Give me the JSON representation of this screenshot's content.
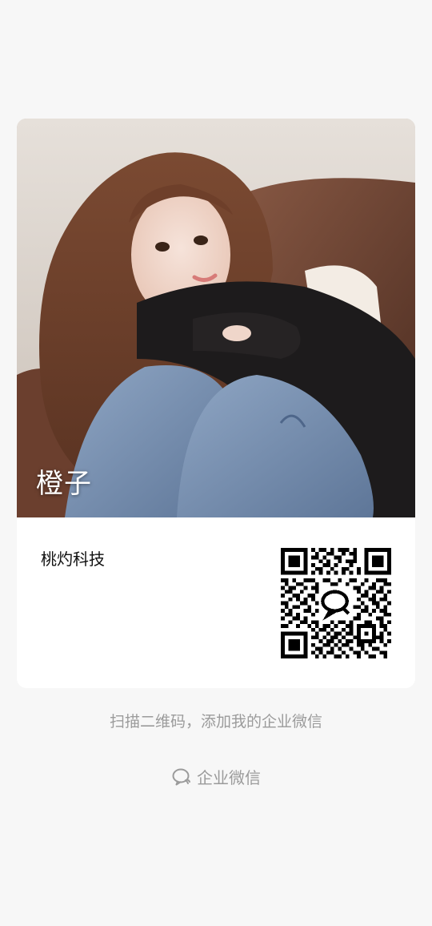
{
  "card": {
    "display_name": "橙子",
    "company": "桃灼科技",
    "photo_icon": "profile-photo",
    "qr_icon": "qr-code-icon"
  },
  "hint": {
    "text": "扫描二维码，添加我的企业微信"
  },
  "footer": {
    "brand_label": "企业微信",
    "brand_icon": "wecom-logo-icon"
  },
  "colors": {
    "background": "#f7f7f7",
    "card": "#ffffff",
    "hint_text": "#9b9b9b"
  }
}
